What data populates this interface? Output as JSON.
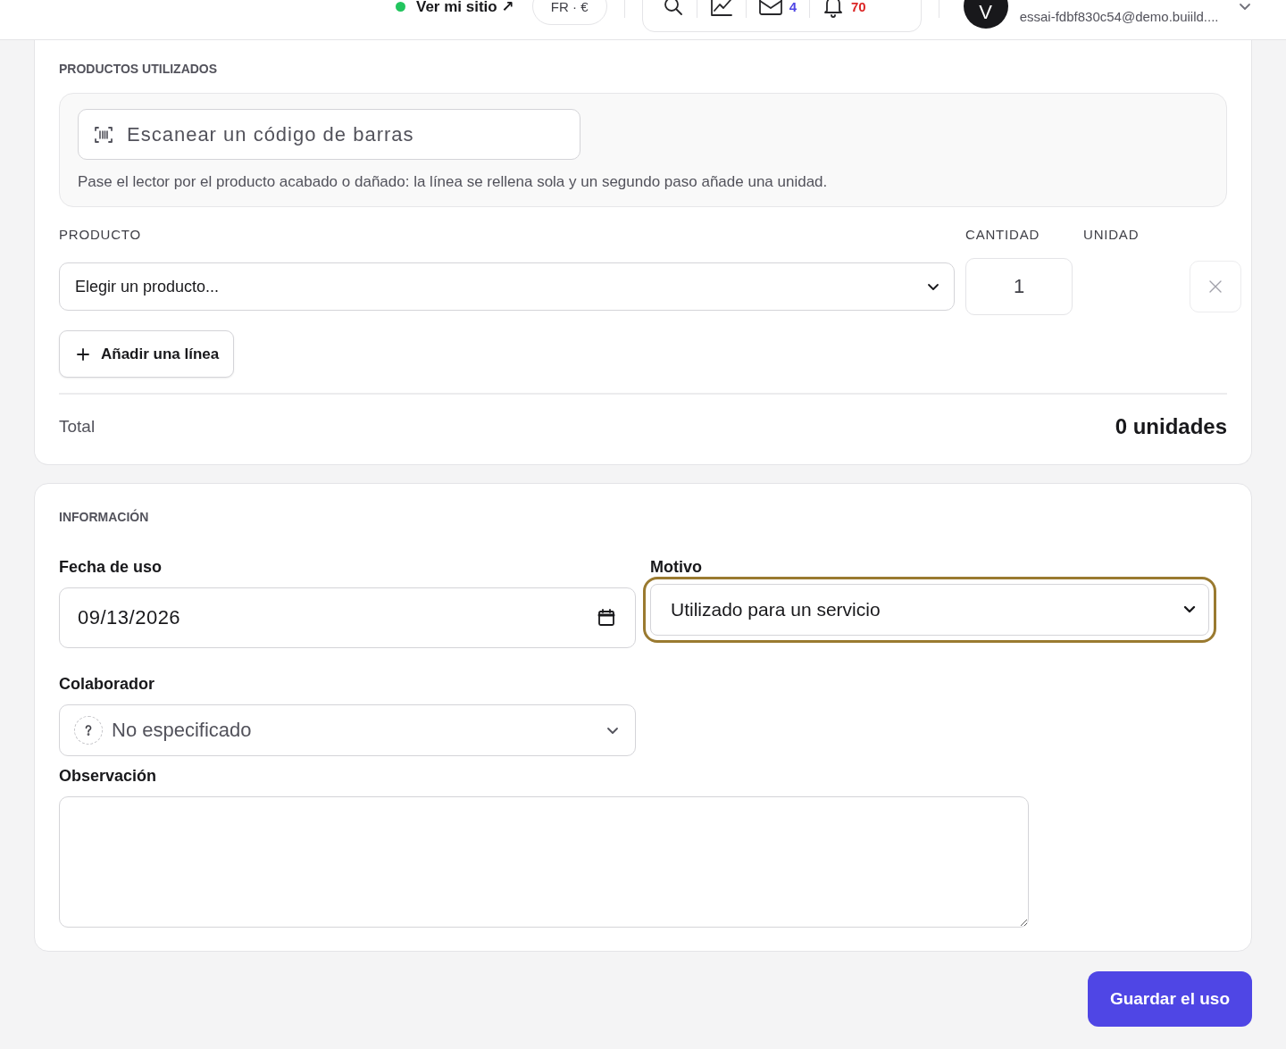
{
  "topbar": {
    "site_link": "Ver mi sitio ↗",
    "site_online": true,
    "locale": "FR · €",
    "messages_count": "4",
    "alerts_count": "70",
    "avatar_initial": "V",
    "user_email": "essai-fdbf830c54@demo.buiild...."
  },
  "products_card": {
    "title": "PRODUCTOS UTILIZADOS",
    "scan": {
      "placeholder": "Escanear un código de barras"
    },
    "scan_hint": "Pase el lector por el producto acabado o dañado: la línea se rellena sola y un segundo paso añade una unidad.",
    "columns": [
      "PRODUCTO",
      "CANTIDAD",
      "UNIDAD"
    ],
    "lines": [
      {
        "product": "Elegir un producto...",
        "quantity": "1"
      }
    ],
    "add_line": "Añadir una línea",
    "total_label": "Total",
    "total_value": "0 unidades"
  },
  "info_card": {
    "title": "INFORMACIÓN",
    "fields": [
      {
        "kind": "date",
        "label": "Fecha de uso",
        "value": "09/13/2026",
        "focused": false
      },
      {
        "kind": "select",
        "label": "Motivo",
        "value": "Utilizado para un servicio",
        "focused": true
      },
      {
        "kind": "person",
        "label": "Colaborador",
        "value": "No especificado",
        "focused": false
      },
      {
        "kind": "textarea",
        "label": "Observación",
        "focused": false
      }
    ]
  },
  "save_button": "Guardar el uso"
}
